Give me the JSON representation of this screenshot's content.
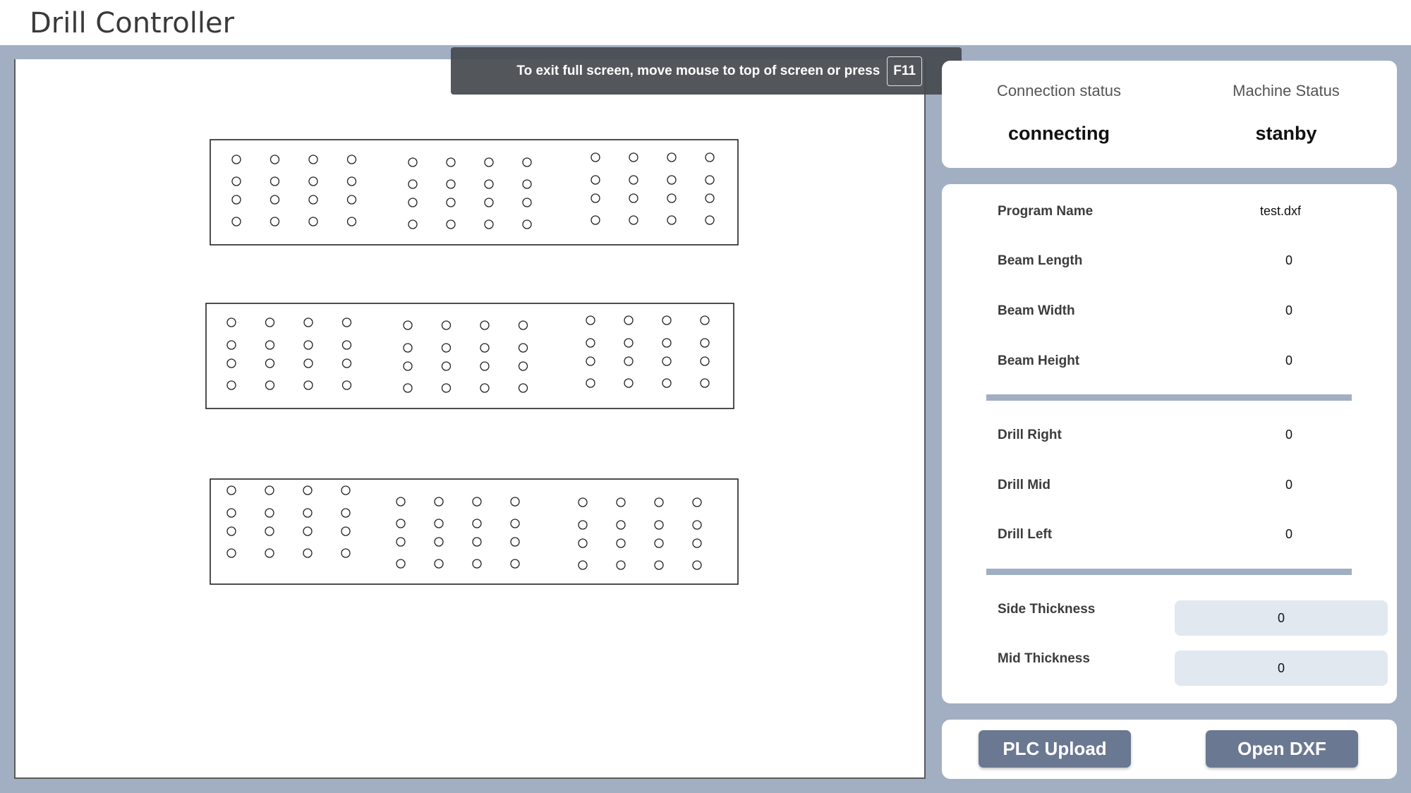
{
  "app": {
    "title": "Drill Controller"
  },
  "toast": {
    "message": "To exit full screen, move mouse to top of screen or press",
    "key": "F11"
  },
  "status": {
    "connection_label": "Connection status",
    "connection_value": "connecting",
    "machine_label": "Machine Status",
    "machine_value": "stanby"
  },
  "info": {
    "program_name_label": "Program Name",
    "program_name_value": "test.dxf",
    "beam_length_label": "Beam Length",
    "beam_length_value": "0",
    "beam_width_label": "Beam Width",
    "beam_width_value": "0",
    "beam_height_label": "Beam Height",
    "beam_height_value": "0",
    "drill_right_label": "Drill Right",
    "drill_right_value": "0",
    "drill_mid_label": "Drill Mid",
    "drill_mid_value": "0",
    "drill_left_label": "Drill Left",
    "drill_left_value": "0",
    "side_thickness_label": "Side Thickness",
    "side_thickness_value": "0",
    "mid_thickness_label": "Mid Thickness",
    "mid_thickness_value": "0"
  },
  "buttons": {
    "plc_upload": "PLC Upload",
    "open_dxf": "Open DXF"
  },
  "drawing": {
    "beams": [
      {
        "name": "beam-top",
        "hole_groups": [
          {
            "columns": 4,
            "rows": 4
          },
          {
            "columns": 4,
            "rows": 4
          },
          {
            "columns": 4,
            "rows": 4
          }
        ]
      },
      {
        "name": "beam-middle",
        "hole_groups": [
          {
            "columns": 4,
            "rows": 4
          },
          {
            "columns": 4,
            "rows": 4
          },
          {
            "columns": 4,
            "rows": 4
          }
        ]
      },
      {
        "name": "beam-bottom",
        "hole_groups": [
          {
            "columns": 4,
            "rows": 4
          },
          {
            "columns": 4,
            "rows": 4
          },
          {
            "columns": 4,
            "rows": 4
          }
        ]
      }
    ]
  }
}
